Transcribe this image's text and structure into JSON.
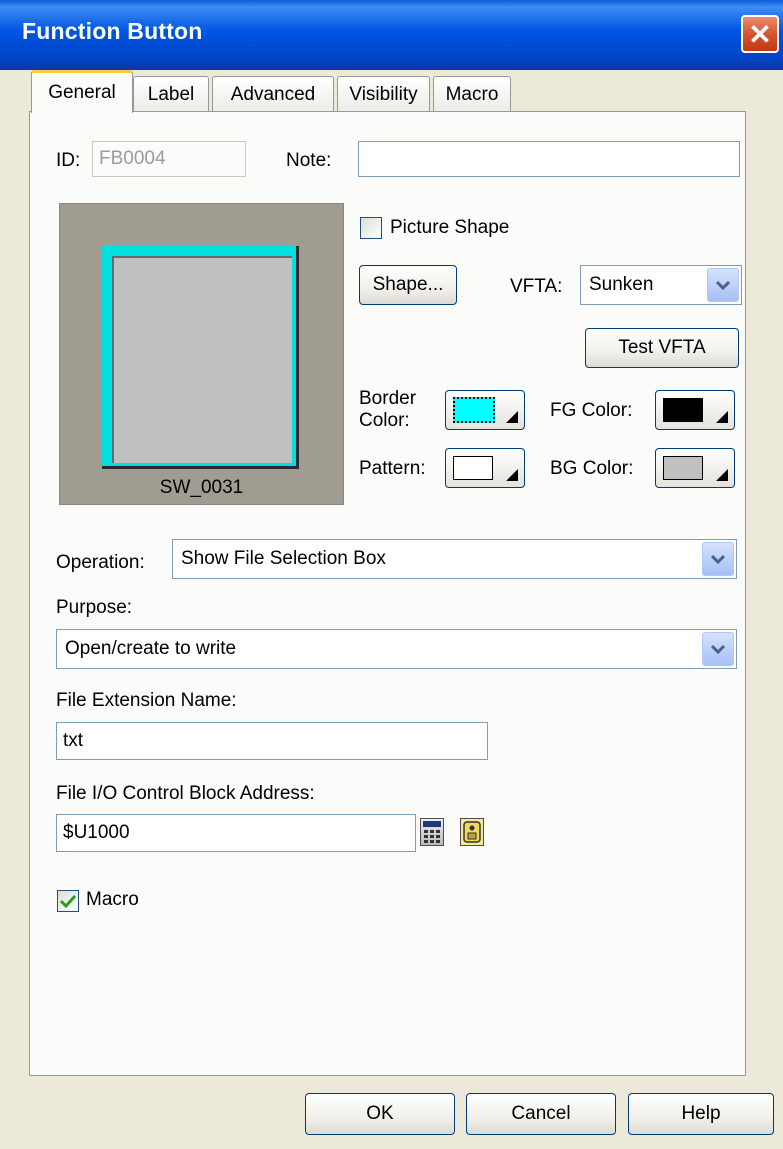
{
  "window": {
    "title": "Function Button",
    "close_glyph": "✕"
  },
  "tabs": [
    {
      "label": "General",
      "active": true
    },
    {
      "label": "Label"
    },
    {
      "label": "Advanced"
    },
    {
      "label": "Visibility"
    },
    {
      "label": "Macro"
    }
  ],
  "general": {
    "id_label": "ID:",
    "id_value": "FB0004",
    "note_label": "Note:",
    "note_value": "",
    "preview_caption": "SW_0031",
    "picture_shape_label": "Picture Shape",
    "picture_shape_checked": false,
    "shape_button": "Shape...",
    "vfta_label": "VFTA:",
    "vfta_value": "Sunken",
    "test_vfta_button": "Test VFTA",
    "border_color_label_1": "Border",
    "border_color_label_2": "Color:",
    "fg_color_label": "FG Color:",
    "pattern_label": "Pattern:",
    "bg_color_label": "BG Color:",
    "operation_label": "Operation:",
    "operation_value": "Show File Selection Box",
    "purpose_label": "Purpose:",
    "purpose_value": "Open/create to write",
    "file_ext_label": "File Extension Name:",
    "file_ext_value": "txt",
    "file_io_label": "File I/O Control Block Address:",
    "file_io_value": "$U1000",
    "macro_label": "Macro",
    "macro_checked": true
  },
  "colors": {
    "border_color": "#00ffff",
    "fg_color": "#000000",
    "pattern": "#ffffff",
    "bg_color": "#c0c0c0",
    "preview_bg": "#a09c92"
  },
  "icons": {
    "combo_arrow": "chevron-down-icon",
    "address_calc": "calculator-icon",
    "address_tag": "tag-icon"
  },
  "footer": {
    "ok": "OK",
    "cancel": "Cancel",
    "help": "Help"
  }
}
